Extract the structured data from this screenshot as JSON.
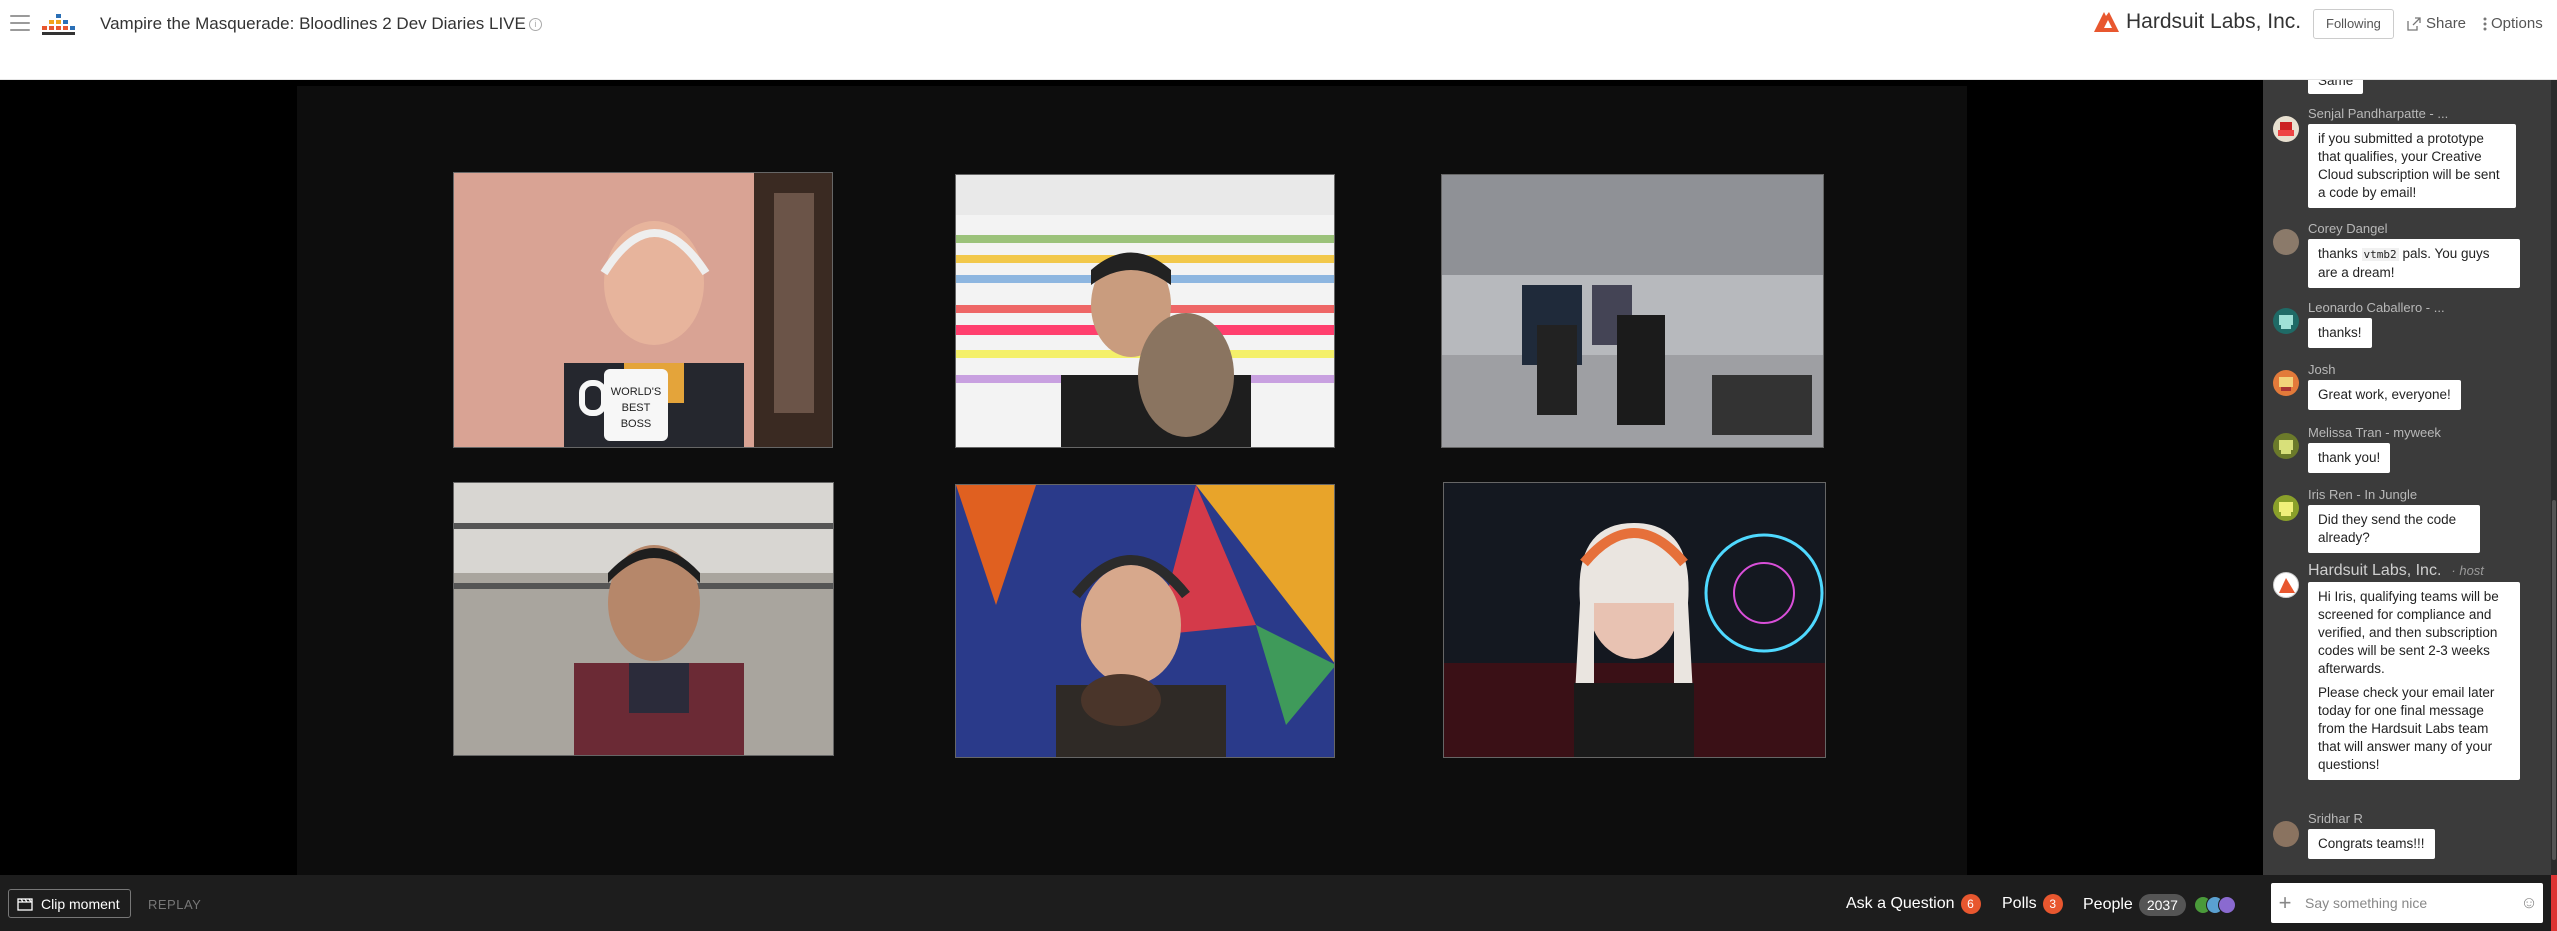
{
  "header": {
    "title": "Vampire the Masquerade: Bloodlines 2 Dev Diaries LIVE",
    "brand_name": "Hardsuit Labs, Inc.",
    "following_label": "Following",
    "share_label": "Share",
    "options_label": "Options"
  },
  "chat": {
    "top_partial": "Same",
    "messages": [
      {
        "user": "Senjal Pandharpatte - ...",
        "text": "if you submitted a prototype that qualifies, your Creative Cloud subscription will be sent a code by email!"
      },
      {
        "user": "Corey Dangel",
        "text_before": "thanks",
        "code": "vtmb2",
        "text_after": "pals. You guys are a dream!"
      },
      {
        "user": "Leonardo Caballero - ...",
        "text": "thanks!"
      },
      {
        "user": "Josh",
        "text": "Great work, everyone!"
      },
      {
        "user": "Melissa Tran - myweek",
        "text": "thank you!"
      },
      {
        "user": "Iris Ren - In Jungle",
        "text": "Did they send the code already?"
      },
      {
        "user": "Hardsuit Labs, Inc.",
        "tag": "· host",
        "text": "Hi Iris, qualifying teams will be screened for compliance and verified, and then subscription codes will be sent 2-3 weeks afterwards.",
        "text2": "Please check your email later today for one final message from the Hardsuit Labs  team that will answer many of your questions!"
      },
      {
        "user": "Sridhar R",
        "text": "Congrats teams!!!"
      }
    ],
    "input_placeholder": "Say something nice"
  },
  "bottombar": {
    "clip_label": "Clip moment",
    "replay_label": "REPLAY",
    "ask_label": "Ask a Question",
    "ask_count": "6",
    "polls_label": "Polls",
    "polls_count": "3",
    "people_label": "People",
    "people_count": "2037"
  },
  "colors": {
    "accent": "#e8572f",
    "chat_bg": "#3b3b3b",
    "bottombar_bg": "#1d1d1d"
  }
}
